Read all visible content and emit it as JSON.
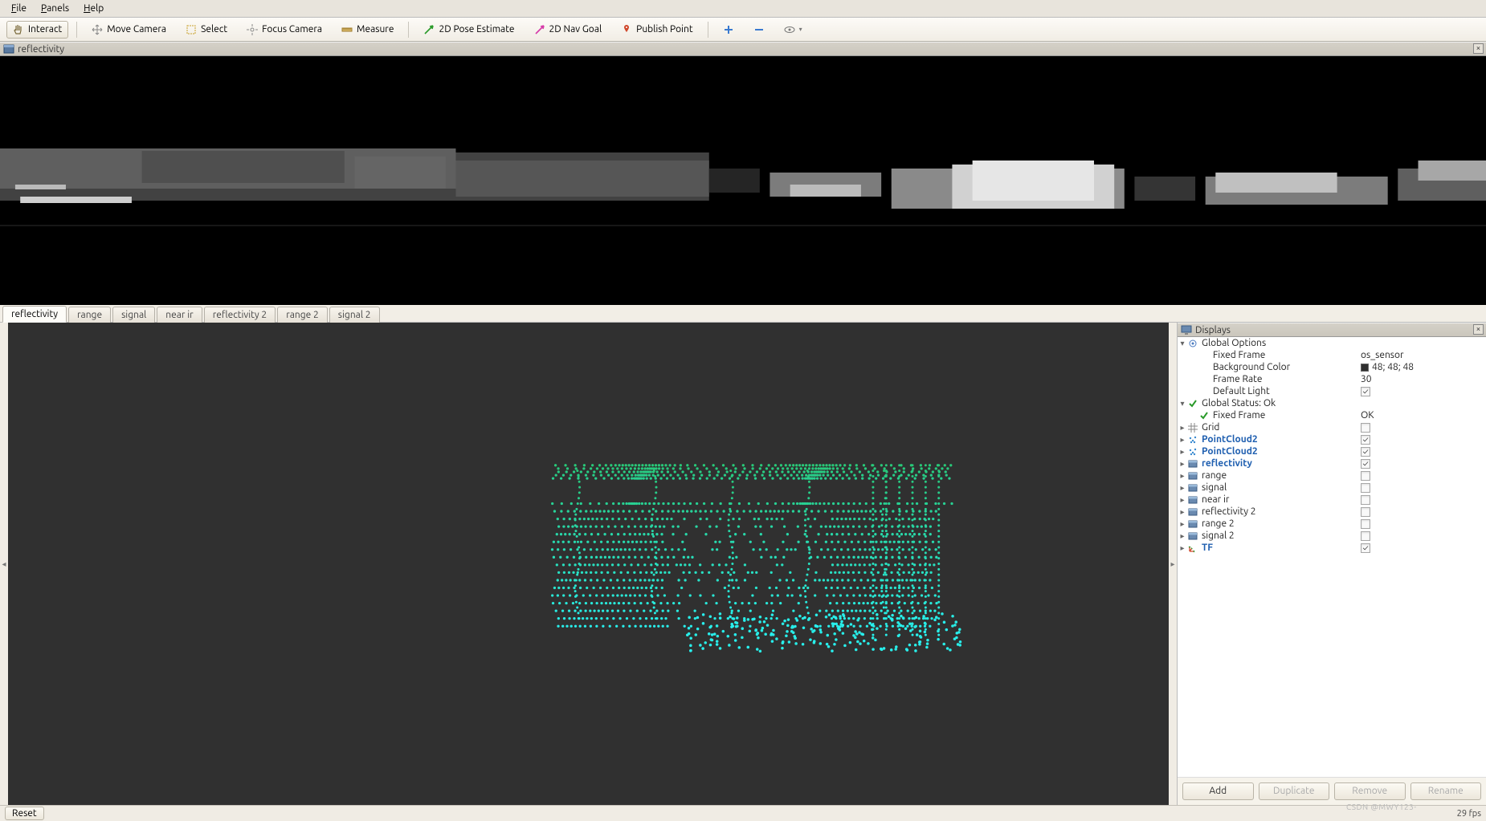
{
  "menubar": [
    "File",
    "Panels",
    "Help"
  ],
  "toolbar": [
    {
      "label": "Interact",
      "icon": "hand",
      "active": true
    },
    {
      "label": "Move Camera",
      "icon": "move",
      "active": false
    },
    {
      "label": "Select",
      "icon": "select",
      "active": false
    },
    {
      "label": "Focus Camera",
      "icon": "focus",
      "active": false
    },
    {
      "label": "Measure",
      "icon": "ruler",
      "active": false
    },
    {
      "label": "2D Pose Estimate",
      "icon": "arrow-green",
      "active": false
    },
    {
      "label": "2D Nav Goal",
      "icon": "arrow-pink",
      "active": false
    },
    {
      "label": "Publish Point",
      "icon": "pin",
      "active": false
    }
  ],
  "view_controls": [
    "plus",
    "minus",
    "eye"
  ],
  "image_panel": {
    "title": "reflectivity"
  },
  "tabs": [
    {
      "label": "reflectivity",
      "active": true
    },
    {
      "label": "range",
      "active": false
    },
    {
      "label": "signal",
      "active": false
    },
    {
      "label": "near ir",
      "active": false
    },
    {
      "label": "reflectivity 2",
      "active": false
    },
    {
      "label": "range 2",
      "active": false
    },
    {
      "label": "signal 2",
      "active": false
    }
  ],
  "displays_panel": {
    "title": "Displays",
    "global_options": {
      "label": "Global Options",
      "items": [
        {
          "k": "Fixed Frame",
          "v": "os_sensor"
        },
        {
          "k": "Background Color",
          "v": "48; 48; 48",
          "swatch": "#303030"
        },
        {
          "k": "Frame Rate",
          "v": "30"
        },
        {
          "k": "Default Light",
          "v": "",
          "check": true
        }
      ]
    },
    "global_status": {
      "label": "Global Status: Ok",
      "items": [
        {
          "k": "Fixed Frame",
          "v": "OK"
        }
      ]
    },
    "displays": [
      {
        "label": "Grid",
        "icon": "grid",
        "bold": false,
        "check": false,
        "expandable": true
      },
      {
        "label": "PointCloud2",
        "icon": "pcl",
        "bold": true,
        "check": true,
        "expandable": true
      },
      {
        "label": "PointCloud2",
        "icon": "pcl",
        "bold": true,
        "check": true,
        "expandable": true
      },
      {
        "label": "reflectivity",
        "icon": "img",
        "bold": true,
        "check": true,
        "expandable": true
      },
      {
        "label": "range",
        "icon": "img",
        "bold": false,
        "check": false,
        "expandable": true
      },
      {
        "label": "signal",
        "icon": "img",
        "bold": false,
        "check": false,
        "expandable": true
      },
      {
        "label": "near ir",
        "icon": "img",
        "bold": false,
        "check": false,
        "expandable": true
      },
      {
        "label": "reflectivity 2",
        "icon": "img",
        "bold": false,
        "check": false,
        "expandable": true
      },
      {
        "label": "range 2",
        "icon": "img",
        "bold": false,
        "check": false,
        "expandable": true
      },
      {
        "label": "signal 2",
        "icon": "img",
        "bold": false,
        "check": false,
        "expandable": true
      },
      {
        "label": "TF",
        "icon": "tf",
        "bold": true,
        "check": true,
        "expandable": true
      }
    ],
    "buttons": [
      "Add",
      "Duplicate",
      "Remove",
      "Rename"
    ]
  },
  "status": {
    "reset": "Reset",
    "fps": "29 fps",
    "watermark": "CSDN @MWY123-"
  }
}
